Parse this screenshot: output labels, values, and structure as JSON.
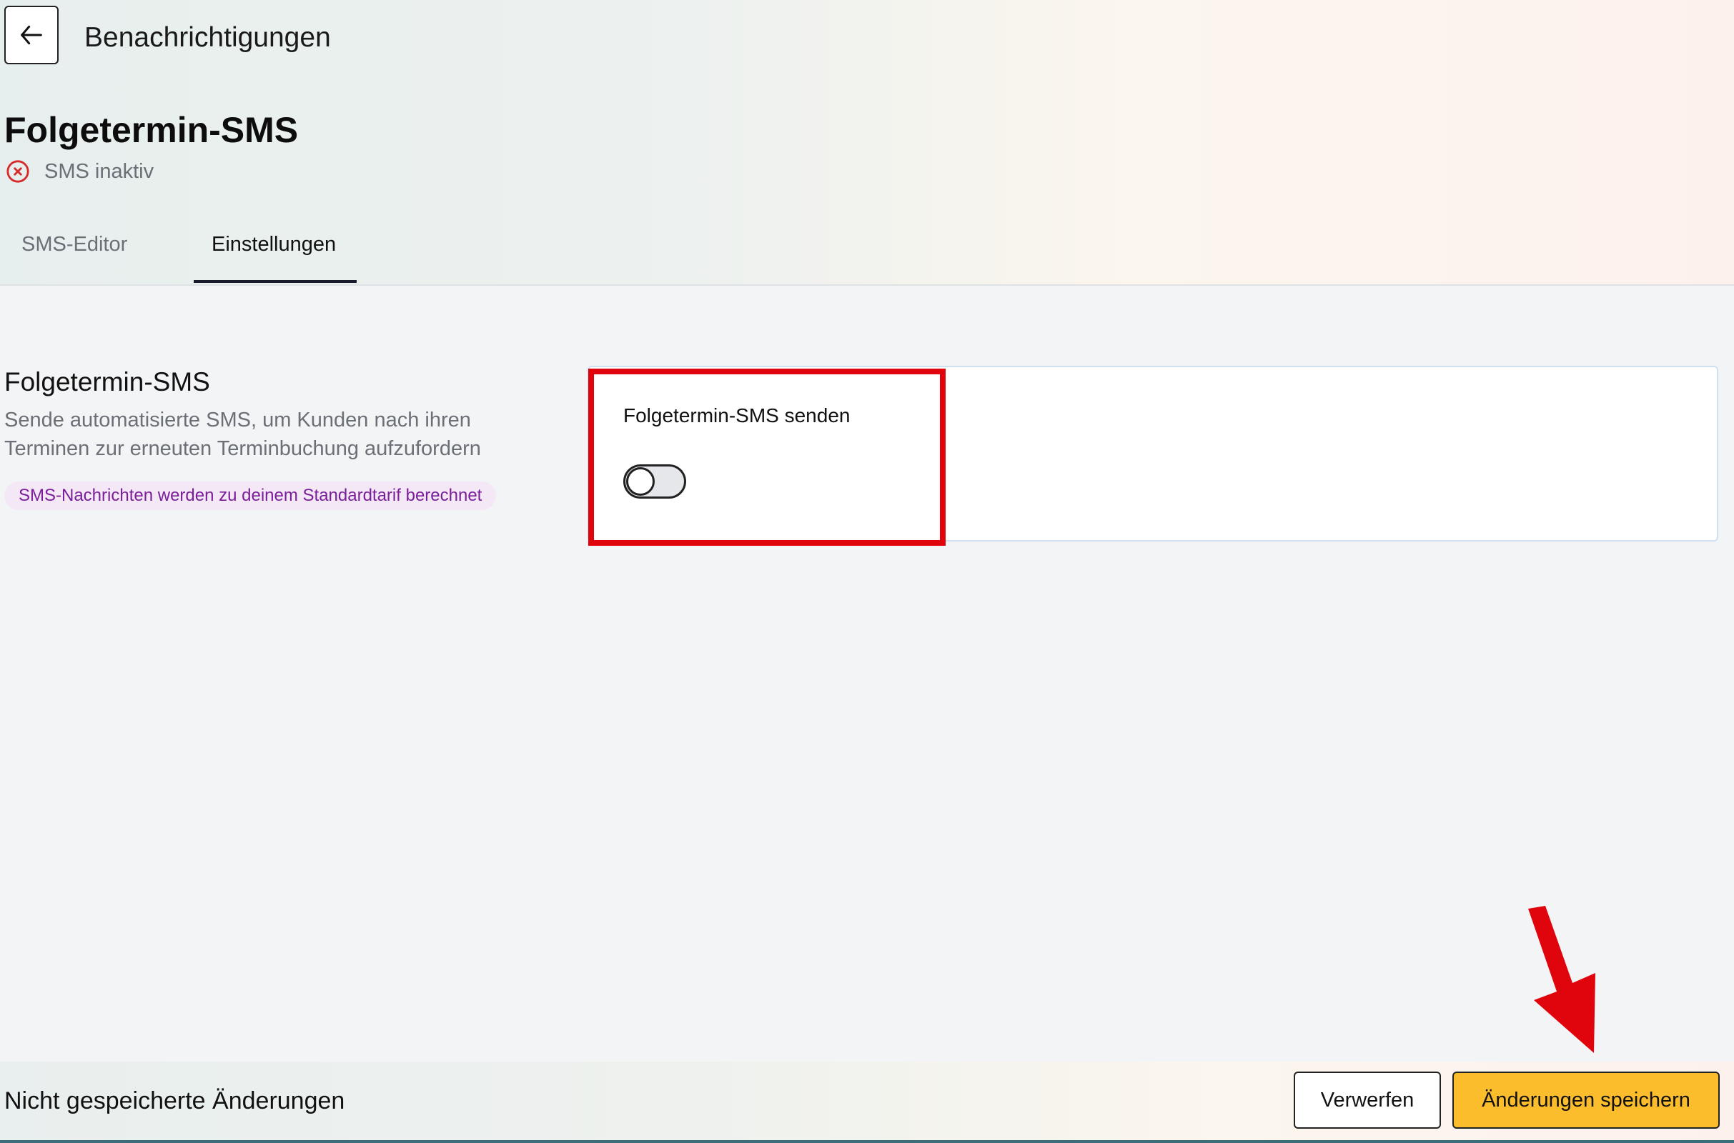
{
  "header": {
    "back_icon": "arrow-left-icon",
    "breadcrumb_title": "Benachrichtigungen",
    "page_title": "Folgetermin-SMS",
    "status": {
      "icon": "x-circle-icon",
      "text": "SMS inaktiv",
      "color": "#d72a2a"
    }
  },
  "tabs": [
    {
      "label": "SMS-Editor",
      "active": false
    },
    {
      "label": "Einstellungen",
      "active": true
    }
  ],
  "section": {
    "title": "Folgetermin-SMS",
    "description": "Sende automatisierte SMS, um Kunden nach ihren Terminen zur erneuten Terminbuchung aufzufordern",
    "badge": "SMS-Nachrichten werden zu deinem Standardtarif berechnet"
  },
  "setting": {
    "label": "Folgetermin-SMS senden",
    "toggle_on": false
  },
  "footer": {
    "unsaved_text": "Nicht gespeicherte Änderungen",
    "discard_label": "Verwerfen",
    "save_label": "Änderungen speichern",
    "save_color": "#fbbd2c"
  },
  "annotations": {
    "highlight_color": "#e0040c",
    "arrow_icon": "red-arrow-down-icon"
  }
}
